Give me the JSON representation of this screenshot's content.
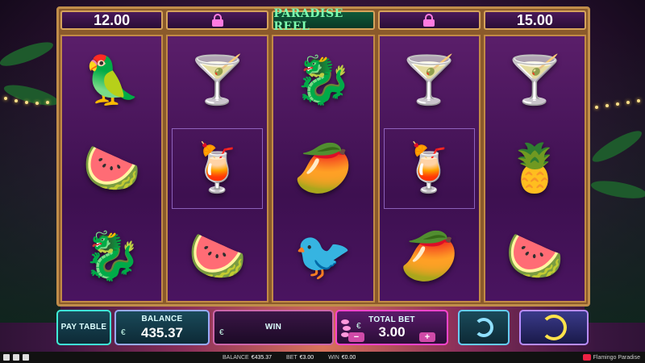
{
  "game": {
    "title": "PARADISE REEL",
    "top_values": [
      "12.00",
      "",
      "",
      "",
      "15.00"
    ],
    "top_locks": [
      false,
      true,
      false,
      true,
      false
    ]
  },
  "reels": [
    [
      "parrot",
      "watermelon",
      "dragon-fruit"
    ],
    [
      "blue-cocktail",
      "orange-cocktail",
      "watermelon"
    ],
    [
      "dragon-fruit",
      "papaya",
      "toucan"
    ],
    [
      "blue-cocktail",
      "orange-cocktail",
      "papaya"
    ],
    [
      "blue-cocktail",
      "pineapple",
      "watermelon"
    ]
  ],
  "symbol_glyphs": {
    "parrot": "🦜",
    "watermelon": "🍉",
    "dragon-fruit": "🐉",
    "blue-cocktail": "🍸",
    "orange-cocktail": "🍹",
    "papaya": "🥭",
    "toucan": "🐦",
    "pineapple": "🍍"
  },
  "controls": {
    "paytable_label": "PAY TABLE",
    "balance_label": "BALANCE",
    "balance_currency": "€",
    "balance_value": "435.37",
    "win_label": "WIN",
    "win_currency": "€",
    "win_value": "",
    "bet_label": "TOTAL BET",
    "bet_currency": "€",
    "bet_value": "3.00",
    "bet_minus": "−",
    "bet_plus": "+"
  },
  "status_bar": {
    "balance_label": "BALANCE",
    "balance_value": "€435.37",
    "bet_label": "BET",
    "bet_value": "€3.00",
    "win_label": "WIN",
    "win_value": "€0.00",
    "brand": "Flamingo Paradise"
  },
  "colors": {
    "frame": "#8b5a2b",
    "reel_bg": "#4a1460",
    "title_text": "#7dffb0",
    "spin_ring": "#ffe24a"
  }
}
